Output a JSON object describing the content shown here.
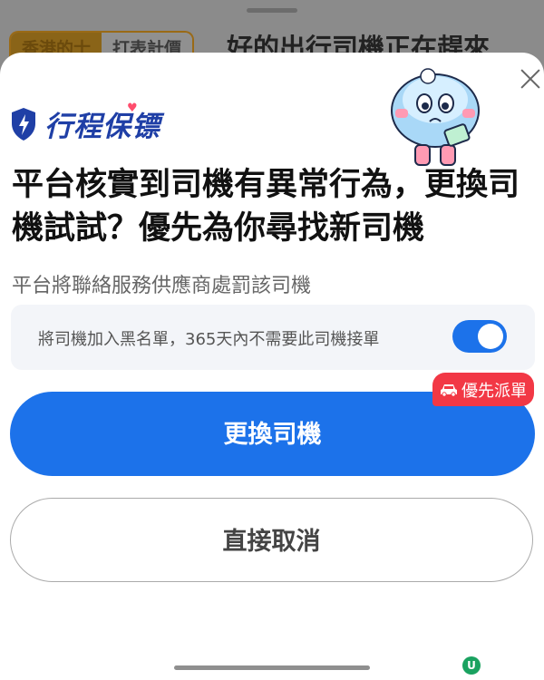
{
  "background": {
    "tabs": [
      "香港的士",
      "打表計價"
    ],
    "title": "好的出行司機正在趕來"
  },
  "brand": {
    "name": "行程保镖"
  },
  "headline": {
    "line1": "平台核實到司機有異常行為，更換司",
    "line2": "機試試？優先為你尋找新司機"
  },
  "subtext": "平台將聯絡服務供應商處罰該司機",
  "blacklist_option": {
    "label": "將司機加入黑名單，365天內不需要此司機接單",
    "enabled": true
  },
  "badge": {
    "label": "優先派單"
  },
  "buttons": {
    "primary_label": "更換司機",
    "secondary_label": "直接取消"
  },
  "colors": {
    "accent": "#1c72ea",
    "badge": "#f23845",
    "brand": "#1f3fa6"
  },
  "icons": [
    "close-icon",
    "shield-icon",
    "car-icon",
    "mascot-illustration"
  ]
}
